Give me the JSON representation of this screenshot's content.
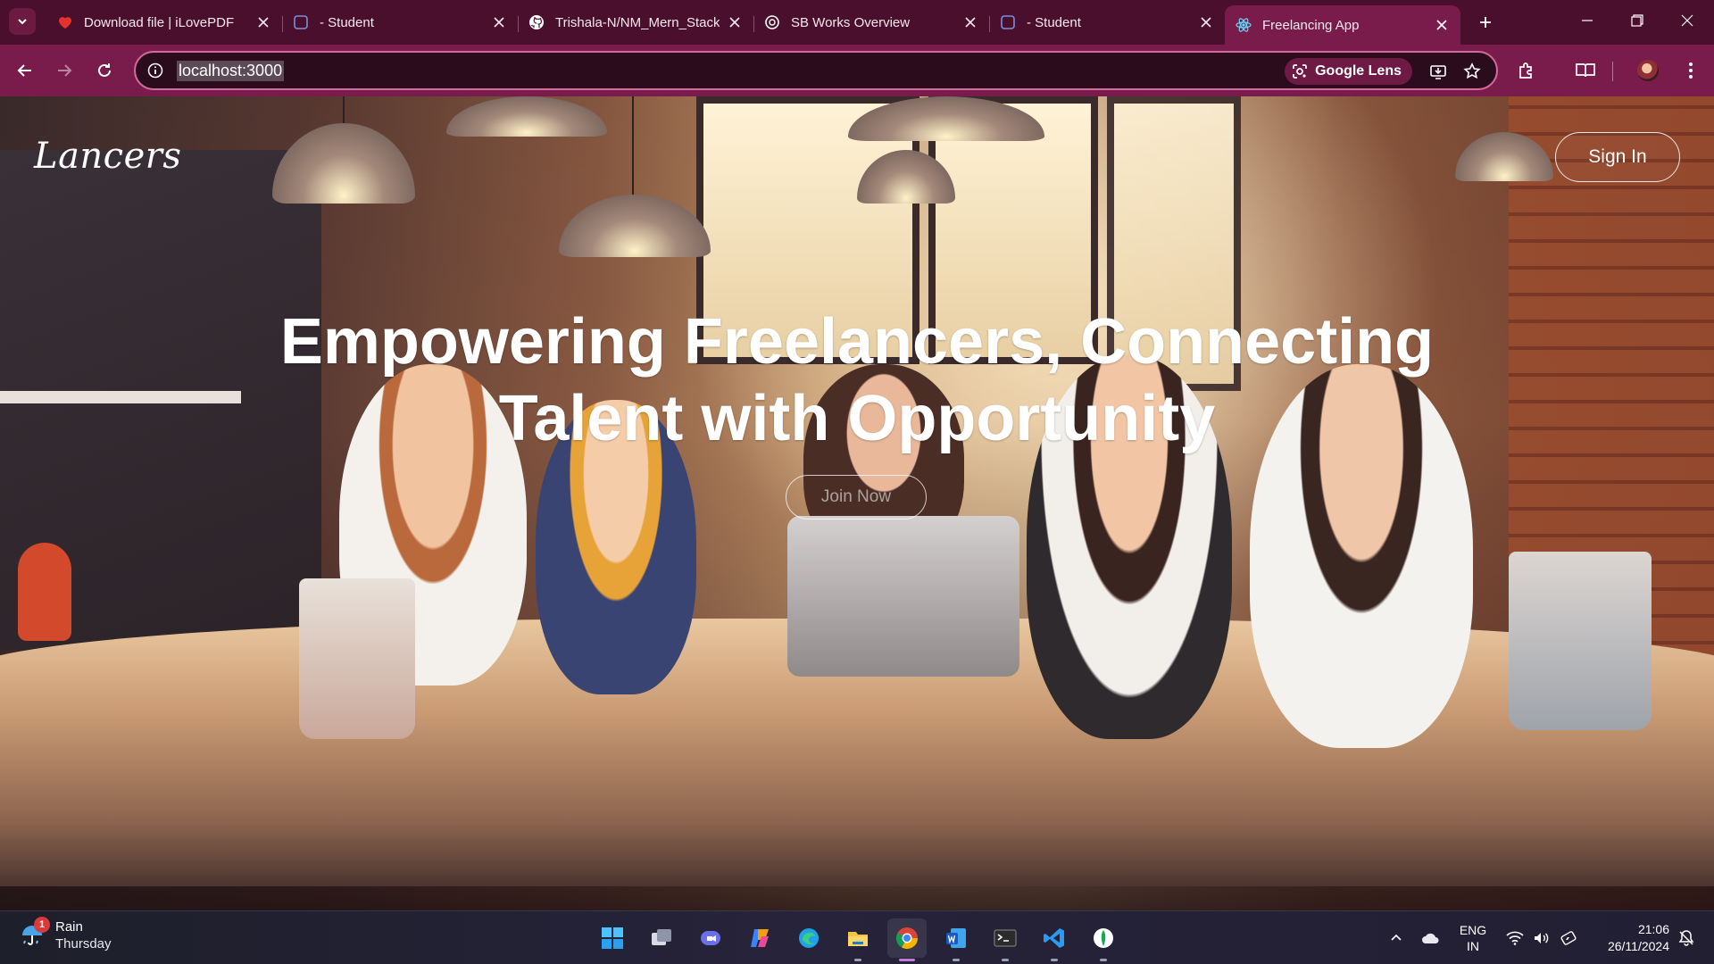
{
  "browser": {
    "tabs": [
      {
        "title": "Download file | iLovePDF",
        "icon": "ilovepdf-heart-icon",
        "active": false
      },
      {
        "title": "- Student",
        "icon": "student-app-icon",
        "active": false
      },
      {
        "title": "Trishala-N/NM_Mern_Stack",
        "icon": "github-icon",
        "active": false
      },
      {
        "title": "SB Works Overview",
        "icon": "openai-icon",
        "active": false
      },
      {
        "title": "- Student",
        "icon": "student-app-icon",
        "active": false
      },
      {
        "title": "Freelancing App",
        "icon": "react-icon",
        "active": true
      }
    ],
    "address": "localhost:3000",
    "google_lens_label": "Google Lens",
    "colors": {
      "frame": "#4a0f2c",
      "toolbar": "#7a1c4b",
      "omnibox_border": "#d56a9d"
    }
  },
  "page": {
    "brand": "Lancers",
    "sign_in_label": "Sign In",
    "hero_line1": "Empowering Freelancers, Connecting",
    "hero_line2": "Talent with Opportunity",
    "join_label": "Join Now",
    "background": "cartoon-office-team-illustration"
  },
  "taskbar": {
    "weather_label": "Rain",
    "weather_day": "Thursday",
    "notification_count": "1",
    "apps": [
      "windows-start-icon",
      "task-view-icon",
      "meet-icon",
      "copilot-icon",
      "edge-icon",
      "file-explorer-icon",
      "chrome-icon",
      "word-icon",
      "terminal-icon",
      "vscode-icon",
      "mongodb-compass-icon"
    ],
    "language_line1": "ENG",
    "language_line2": "IN",
    "time": "21:06",
    "date": "26/11/2024"
  }
}
